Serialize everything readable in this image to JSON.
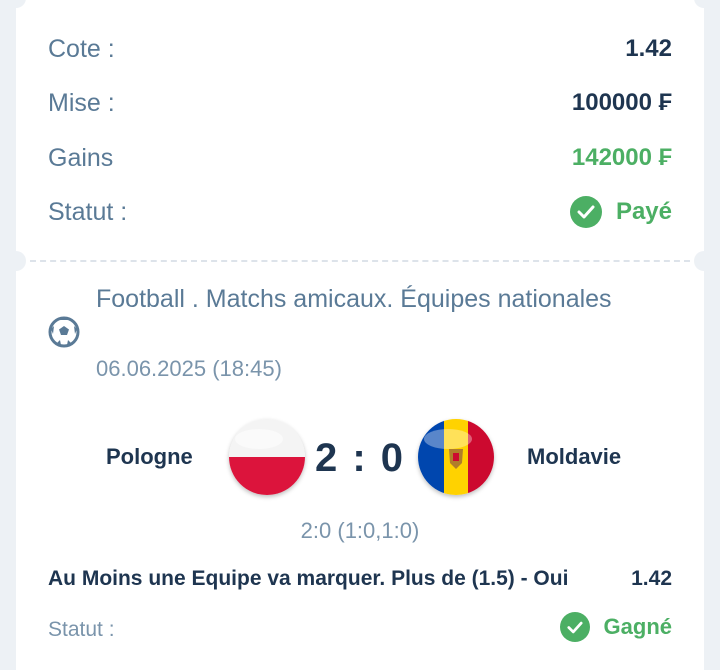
{
  "summary": {
    "odds": {
      "label": "Cote :",
      "value": "1.42"
    },
    "stake": {
      "label": "Mise :",
      "value": "100000 ₣"
    },
    "winnings": {
      "label": "Gains",
      "value": "142000 ₣"
    },
    "status": {
      "label": "Statut :",
      "value": "Payé",
      "icon": "check-circle-icon"
    }
  },
  "event": {
    "sport_icon": "football-icon",
    "title": "Football . Matchs amicaux. Équipes nationales",
    "datetime": "06.06.2025 (18:45)",
    "home_team": "Pologne",
    "away_team": "Moldavie",
    "score": "2 : 0",
    "score_detail": "2:0 (1:0,1:0)",
    "market": "Au Moins une Equipe va marquer. Plus de (1.5) - Oui",
    "market_odds": "1.42",
    "status_label": "Statut :",
    "status_value": "Gagné"
  },
  "colors": {
    "label": "#5a7a96",
    "value": "#1e3550",
    "success": "#4caf64",
    "background": "#edf1f5"
  }
}
